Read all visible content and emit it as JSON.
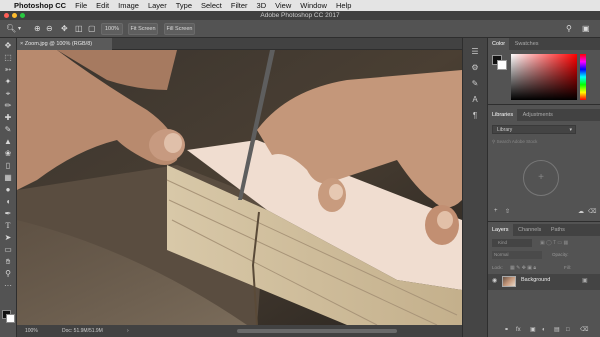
{
  "menubar": {
    "apple": "",
    "app": "Photoshop CC",
    "items": [
      "File",
      "Edit",
      "Image",
      "Layer",
      "Type",
      "Select",
      "Filter",
      "3D",
      "View",
      "Window",
      "Help"
    ]
  },
  "window": {
    "title": "Adobe Photoshop CC 2017"
  },
  "options": {
    "zoom": "100%",
    "fit_screen": "Fit Screen",
    "fill_screen": "Fill Screen"
  },
  "document": {
    "tab": "Zoom.jpg @ 100% (RGB/8)"
  },
  "status": {
    "zoom": "100%",
    "doc": "Doc: 51.9M/51.9M"
  },
  "panels": {
    "color": {
      "tabs": [
        "Color",
        "Swatches"
      ]
    },
    "libraries": {
      "tabs": [
        "Libraries",
        "Adjustments"
      ],
      "library": "Library",
      "search": "Search Adobe Stock"
    },
    "layers": {
      "tabs": [
        "Layers",
        "Channels",
        "Paths"
      ],
      "kind": "Kind",
      "mode": "Normal",
      "opacity_label": "Opacity:",
      "lock_label": "Lock:",
      "fill_label": "Fill:",
      "layer_name": "Background"
    }
  },
  "colors": {
    "foreground": "#111111",
    "background": "#ffffff",
    "accent": "#ff0000"
  }
}
